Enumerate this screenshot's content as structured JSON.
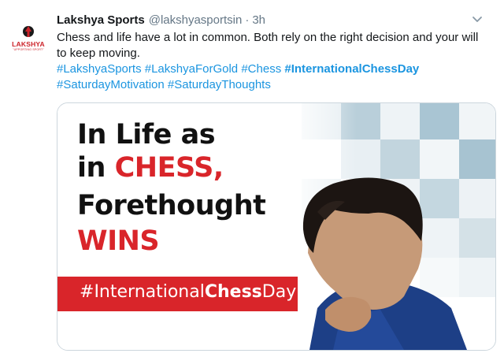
{
  "account": {
    "display_name": "Lakshya Sports",
    "handle": "@lakshyasportsin",
    "separator": "·",
    "time": "3h",
    "avatar_brand": "LAKSHYA",
    "avatar_tagline": "SUPPORTING SPORTS"
  },
  "tweet": {
    "text": "Chess and life have a lot in common. Both rely on the right decision and your will to keep moving.",
    "hashtags": [
      "#LakshyaSports",
      "#LakshyaForGold",
      "#Chess",
      "#InternationalChessDay",
      "#SaturdayMotivation",
      "#SaturdayThoughts"
    ]
  },
  "media": {
    "line1": "In Life as",
    "line2_prefix": "in ",
    "line2_red": "CHESS,",
    "line3": "Forethought",
    "line4_red": "WINS",
    "banner_hash": "#",
    "banner_part1": "International",
    "banner_bold": "Chess",
    "banner_part2": "Day"
  },
  "colors": {
    "link": "#1b95e0",
    "text": "#14171a",
    "muted": "#657786",
    "accent_red": "#d9252a"
  },
  "icons": {
    "menu": "chevron-down-icon"
  }
}
